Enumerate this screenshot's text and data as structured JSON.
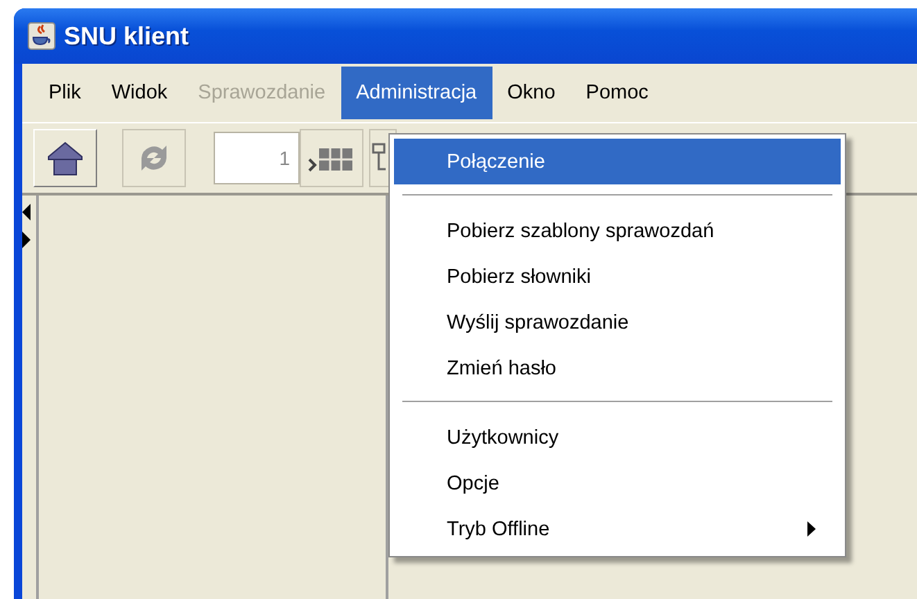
{
  "window": {
    "title": "SNU klient"
  },
  "menu_bar": [
    {
      "label": "Plik",
      "selected": false,
      "disabled": false
    },
    {
      "label": "Widok",
      "selected": false,
      "disabled": false
    },
    {
      "label": "Sprawozdanie",
      "selected": false,
      "disabled": true
    },
    {
      "label": "Administracja",
      "selected": true,
      "disabled": false
    },
    {
      "label": "Okno",
      "selected": false,
      "disabled": false
    },
    {
      "label": "Pomoc",
      "selected": false,
      "disabled": false
    }
  ],
  "toolbar": {
    "buttons": [
      {
        "kind": "home",
        "disabled": false
      },
      {
        "kind": "refresh",
        "disabled": true
      }
    ],
    "page_field": {
      "value": "1"
    }
  },
  "dropdown": {
    "items": [
      {
        "kind": "item",
        "label": "Połączenie",
        "selected": true
      },
      {
        "kind": "separator"
      },
      {
        "kind": "item",
        "label": "Pobierz szablony sprawozdań",
        "selected": false
      },
      {
        "kind": "item",
        "label": "Pobierz słowniki",
        "selected": false
      },
      {
        "kind": "item",
        "label": "Wyślij sprawozdanie",
        "selected": false
      },
      {
        "kind": "item",
        "label": "Zmień hasło",
        "selected": false
      },
      {
        "kind": "separator"
      },
      {
        "kind": "item",
        "label": "Użytkownicy",
        "selected": false
      },
      {
        "kind": "item",
        "label": "Opcje",
        "selected": false
      },
      {
        "kind": "submenu",
        "label": "Tryb Offline",
        "selected": false
      }
    ]
  }
}
